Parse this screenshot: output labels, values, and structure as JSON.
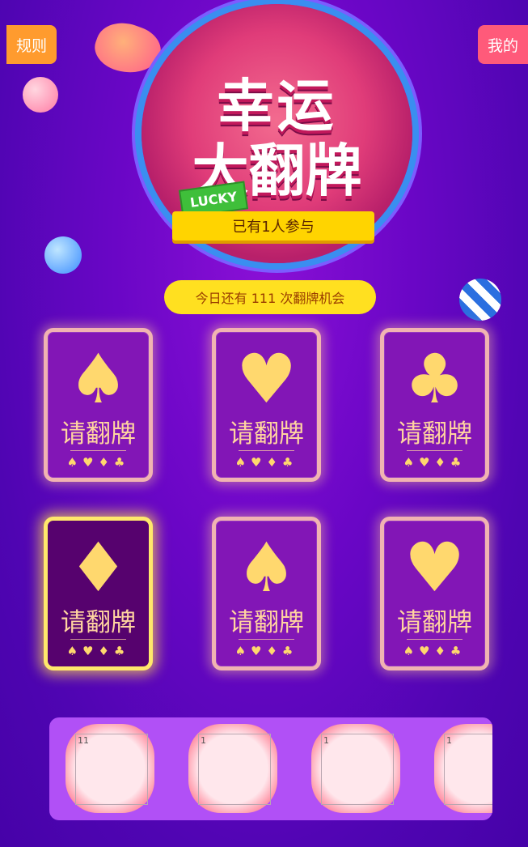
{
  "header": {
    "rules_label": "规则",
    "mine_label": "我的"
  },
  "hero": {
    "title_line1": "幸运",
    "title_line2": "大翻牌",
    "lucky_tag": "LUCKY",
    "participants_text": "已有1人参与"
  },
  "chances_text": "今日还有 111 次翻牌机会",
  "colors": {
    "bg": "#5a05b8",
    "card": "#8216b6",
    "card_active": "#56026e",
    "accent_yellow": "#ffe020",
    "rules_btn": "#ff9b2e",
    "mine_btn": "#ff5a7a"
  },
  "cards": [
    {
      "suit": "♠",
      "icon": "spade-icon",
      "label": "请翻牌",
      "mini": "♠♥♦♣",
      "active": false
    },
    {
      "suit": "♥",
      "icon": "heart-icon",
      "label": "请翻牌",
      "mini": "♠♥♦♣",
      "active": false
    },
    {
      "suit": "♣",
      "icon": "club-icon",
      "label": "请翻牌",
      "mini": "♠♥♦♣",
      "active": false
    },
    {
      "suit": "♦",
      "icon": "diamond-icon",
      "label": "请翻牌",
      "mini": "♠♥♦♣",
      "active": true
    },
    {
      "suit": "♠",
      "icon": "spade-icon",
      "label": "请翻牌",
      "mini": "♠♥♦♣",
      "active": false
    },
    {
      "suit": "♥",
      "icon": "heart-icon",
      "label": "请翻牌",
      "mini": "♠♥♦♣",
      "active": false
    }
  ],
  "prizes": [
    {
      "alt": "11"
    },
    {
      "alt": "1"
    },
    {
      "alt": "1"
    },
    {
      "alt": "1"
    }
  ]
}
